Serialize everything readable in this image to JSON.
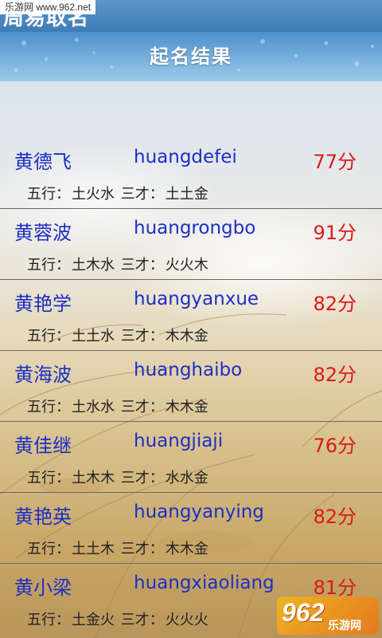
{
  "watermark": {
    "site": "乐游网 www.962.net"
  },
  "app": {
    "name": "周易取名"
  },
  "header": {
    "title": "起名结果"
  },
  "results": [
    {
      "name": "黄德飞",
      "pinyin": "huangdefei",
      "score": "77分",
      "wuxing_label": "五行：",
      "wuxing": "土火水",
      "sancai_label": "三才：",
      "sancai": "土土金"
    },
    {
      "name": "黄蓉波",
      "pinyin": "huangrongbo",
      "score": "91分",
      "wuxing_label": "五行：",
      "wuxing": "土木水",
      "sancai_label": "三才：",
      "sancai": "火火木"
    },
    {
      "name": "黄艳学",
      "pinyin": "huangyanxue",
      "score": "82分",
      "wuxing_label": "五行：",
      "wuxing": "土土水",
      "sancai_label": "三才：",
      "sancai": "木木金"
    },
    {
      "name": "黄海波",
      "pinyin": "huanghaibo",
      "score": "82分",
      "wuxing_label": "五行：",
      "wuxing": "土水水",
      "sancai_label": "三才：",
      "sancai": "木木金"
    },
    {
      "name": "黄佳继",
      "pinyin": "huangjiaji",
      "score": "76分",
      "wuxing_label": "五行：",
      "wuxing": "土木木",
      "sancai_label": "三才：",
      "sancai": "水水金"
    },
    {
      "name": "黄艳英",
      "pinyin": "huangyanying",
      "score": "82分",
      "wuxing_label": "五行：",
      "wuxing": "土土木",
      "sancai_label": "三才：",
      "sancai": "木木金"
    },
    {
      "name": "黄小梁",
      "pinyin": "huangxiaoliang",
      "score": "81分",
      "wuxing_label": "五行：",
      "wuxing": "土金火",
      "sancai_label": "三才：",
      "sancai": "火火火"
    }
  ],
  "brand": {
    "number": "962",
    "site": "乐游网"
  },
  "colors": {
    "name": "#1c2fc4",
    "score": "#d91a1a",
    "title_bar": "#4c8fcb"
  }
}
